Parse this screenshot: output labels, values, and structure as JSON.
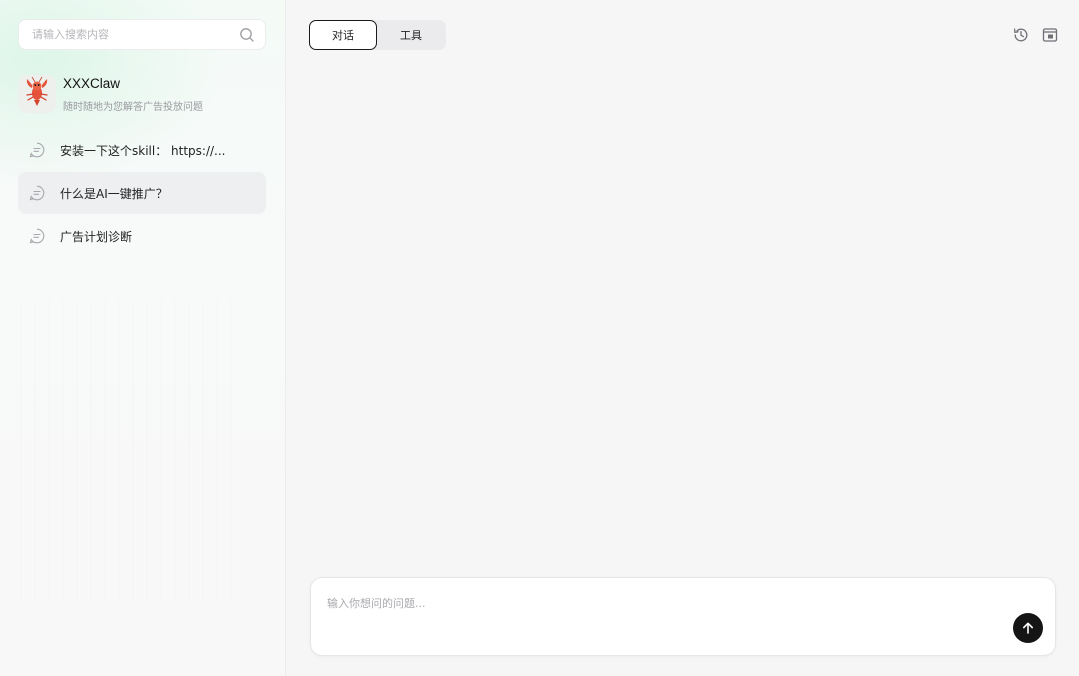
{
  "sidebar": {
    "search": {
      "placeholder": "请输入搜索内容",
      "value": ""
    },
    "agent": {
      "name": "XXXClaw",
      "description": "随时随地为您解答广告投放问题",
      "avatar_icon": "lobster-icon"
    },
    "conversations": [
      {
        "label": "安装一下这个skill： https://...",
        "active": false
      },
      {
        "label": "什么是AI一键推广？",
        "active": true
      },
      {
        "label": "广告计划诊断",
        "active": false
      }
    ]
  },
  "main": {
    "tabs": [
      {
        "label": "对话",
        "active": true
      },
      {
        "label": "工具",
        "active": false
      }
    ],
    "actions": [
      "history-icon",
      "sidebar-toggle-icon"
    ],
    "composer": {
      "placeholder": "输入你想问的问题...",
      "value": ""
    }
  },
  "colors": {
    "accent": "#151515",
    "avatar_red": "#e4533a"
  }
}
